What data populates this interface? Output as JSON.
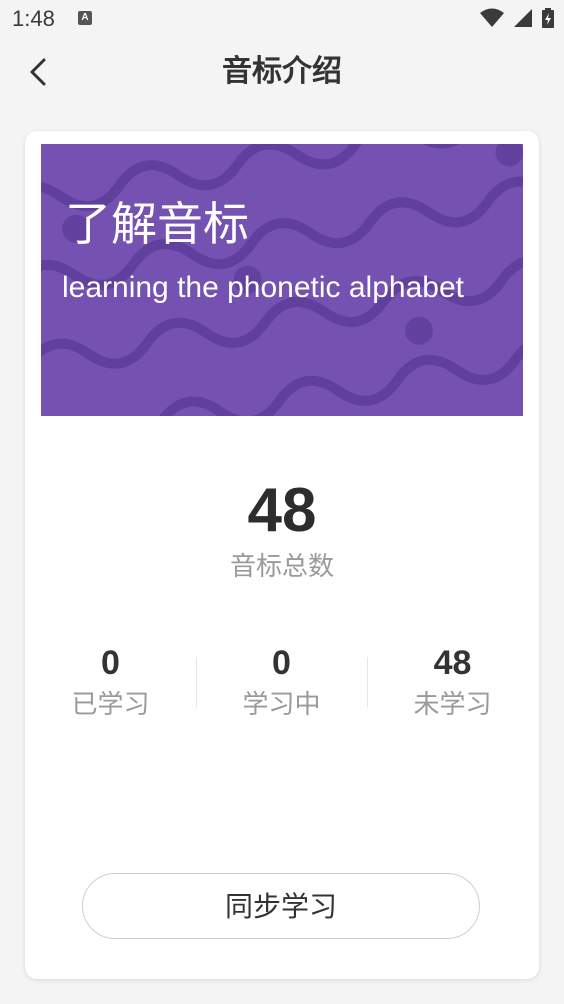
{
  "status_bar": {
    "time": "1:48",
    "app_icon": "A"
  },
  "header": {
    "title": "音标介绍"
  },
  "banner": {
    "title": "了解音标",
    "subtitle": "learning the phonetic alphabet",
    "background_color": "#7552b1"
  },
  "summary": {
    "total_value": "48",
    "total_label": "音标总数"
  },
  "stats": [
    {
      "value": "0",
      "label": "已学习"
    },
    {
      "value": "0",
      "label": "学习中"
    },
    {
      "value": "48",
      "label": "未学习"
    }
  ],
  "actions": {
    "sync_label": "同步学习"
  }
}
